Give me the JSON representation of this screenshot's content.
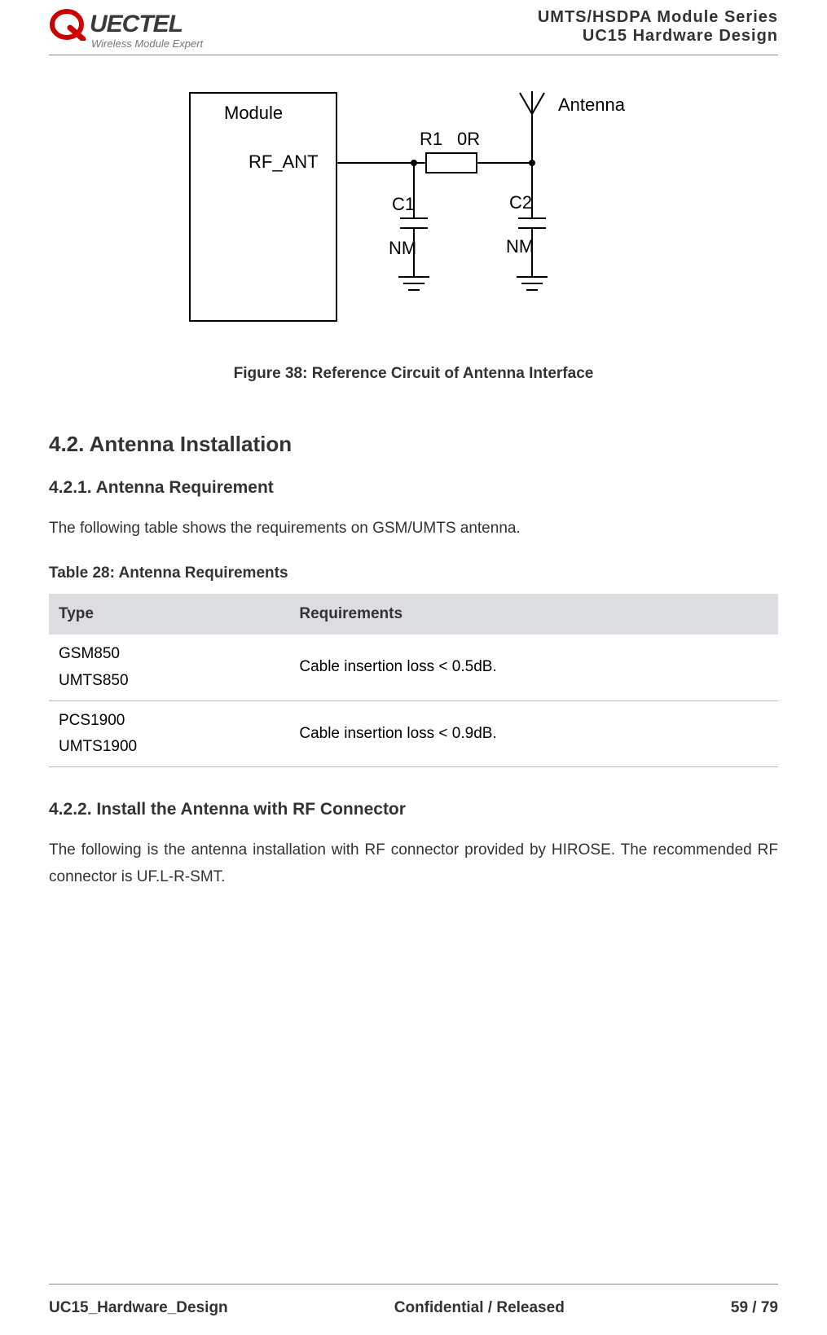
{
  "header": {
    "brand_rest": "UECTEL",
    "tagline": "Wireless Module Expert",
    "doc_title_1": "UMTS/HSDPA Module Series",
    "doc_title_2": "UC15 Hardware Design"
  },
  "figure": {
    "caption": "Figure 38: Reference Circuit of Antenna Interface",
    "labels": {
      "module": "Module",
      "rf_ant": "RF_ANT",
      "r1": "R1",
      "r1_val": "0R",
      "c1": "C1",
      "c2": "C2",
      "nm1": "NM",
      "nm2": "NM",
      "antenna": "Antenna"
    }
  },
  "section": {
    "h2": "4.2. Antenna Installation",
    "h3a": "4.2.1.    Antenna Requirement",
    "p1": "The following table shows the requirements on GSM/UMTS antenna.",
    "table_caption": "Table 28: Antenna Requirements",
    "h3b": "4.2.2.    Install the Antenna with RF Connector",
    "p2": "The following is the antenna installation with RF connector provided by HIROSE. The recommended RF connector is UF.L-R-SMT."
  },
  "table": {
    "headers": {
      "col1": "Type",
      "col2": "Requirements"
    },
    "rows": [
      {
        "type": "GSM850\nUMTS850",
        "req": "Cable insertion loss < 0.5dB."
      },
      {
        "type": "PCS1900\nUMTS1900",
        "req": "Cable insertion loss < 0.9dB."
      }
    ]
  },
  "footer": {
    "left": "UC15_Hardware_Design",
    "center": "Confidential / Released",
    "right": "59 / 79"
  }
}
